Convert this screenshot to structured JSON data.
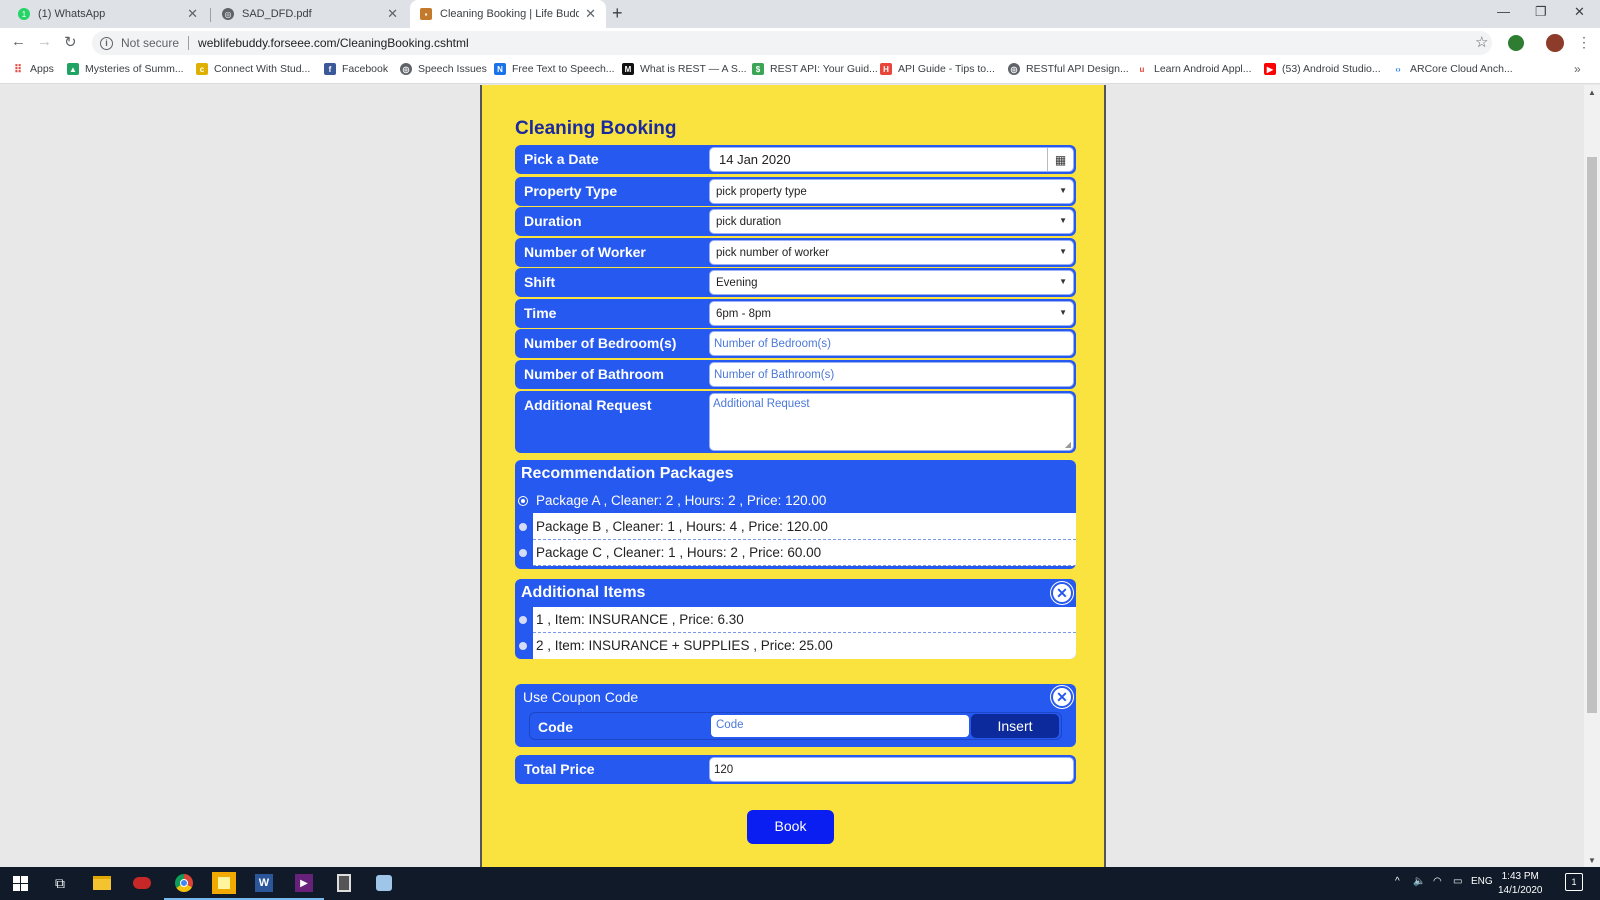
{
  "browser": {
    "tabs": [
      {
        "title": "(1) WhatsApp",
        "icon": "whatsapp-icon"
      },
      {
        "title": "SAD_DFD.pdf",
        "icon": "globe-icon"
      },
      {
        "title": "Cleaning Booking | Life Buddy",
        "icon": "site-icon"
      }
    ],
    "security_label": "Not secure",
    "url": "weblifebuddy.forseee.com/CleaningBooking.cshtml",
    "bookmarks": [
      "Apps",
      "Mysteries of Summ...",
      "Connect With Stud...",
      "Facebook",
      "Speech Issues",
      "Free Text to Speech...",
      "What is REST — A S...",
      "REST API: Your Guid...",
      "API Guide - Tips to...",
      "RESTful API Design...",
      "Learn Android Appl...",
      "(53) Android Studio...",
      "ARCore Cloud Anch..."
    ]
  },
  "page": {
    "title": "Cleaning Booking",
    "fields": {
      "date": {
        "label": "Pick a Date",
        "value": "14 Jan 2020"
      },
      "property_type": {
        "label": "Property Type",
        "value": "pick property type"
      },
      "duration": {
        "label": "Duration",
        "value": "pick duration"
      },
      "workers": {
        "label": "Number of Worker",
        "value": "pick number of worker"
      },
      "shift": {
        "label": "Shift",
        "value": "Evening"
      },
      "time": {
        "label": "Time",
        "value": "6pm - 8pm"
      },
      "bedrooms": {
        "label": "Number of Bedroom(s)",
        "placeholder": "Number of Bedroom(s)"
      },
      "bathrooms": {
        "label": "Number of Bathroom",
        "placeholder": "Number of Bathroom(s)"
      },
      "additional_request": {
        "label": "Additional Request",
        "placeholder": "Additional Request"
      }
    },
    "packages": {
      "title": "Recommendation Packages",
      "items": [
        "Package A , Cleaner: 2 , Hours: 2 , Price: 120.00",
        "Package B , Cleaner: 1 , Hours: 4 , Price: 120.00",
        "Package C , Cleaner: 1 , Hours: 2 , Price: 60.00"
      ],
      "selected_index": 0
    },
    "additional_items": {
      "title": "Additional Items",
      "items": [
        "1 , Item: INSURANCE , Price: 6.30",
        "2 , Item: INSURANCE + SUPPLIES , Price: 25.00"
      ]
    },
    "coupon": {
      "title": "Use Coupon Code",
      "label": "Code",
      "placeholder": "Code",
      "button": "Insert"
    },
    "total": {
      "label": "Total Price",
      "value": "120"
    },
    "book_button": "Book"
  },
  "taskbar": {
    "language": "ENG",
    "time": "1:43 PM",
    "date": "14/1/2020",
    "notifications": "1"
  },
  "colors": {
    "page_background": "#fae23f",
    "form_blue": "#2659f0",
    "title_blue": "#1a2a9e",
    "book_button": "#0a1ef2"
  }
}
